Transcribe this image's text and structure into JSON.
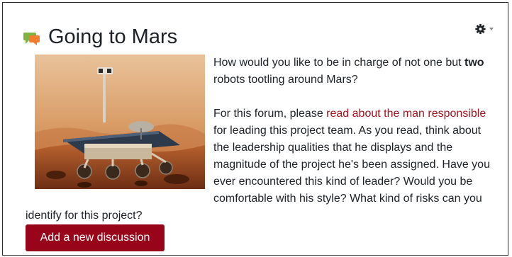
{
  "forum": {
    "title": "Going to Mars",
    "icon": "forum-icon",
    "settings_icon": "gear-icon",
    "image_alt": "Mars rover on red Martian terrain",
    "intro_p1_before": "How would you like to be in charge of not one but ",
    "intro_p1_bold": "two",
    "intro_p1_after": " robots tootling around Mars?",
    "intro_p2_before": "For this forum, please ",
    "intro_p2_link": "read about the man responsible",
    "intro_p2_after": " for leading this project team. As you read, think about the leadership qualities that he displays and the magnitude of the project he's been assigned. Have you ever encountered this kind of leader? Would you be comfortable with his style? What kind of risks can you identify for this project?",
    "add_button_label": "Add a new discussion"
  },
  "colors": {
    "link": "#a3121b",
    "button_bg": "#98051b",
    "button_text": "#ffffff",
    "text": "#1d2125"
  }
}
